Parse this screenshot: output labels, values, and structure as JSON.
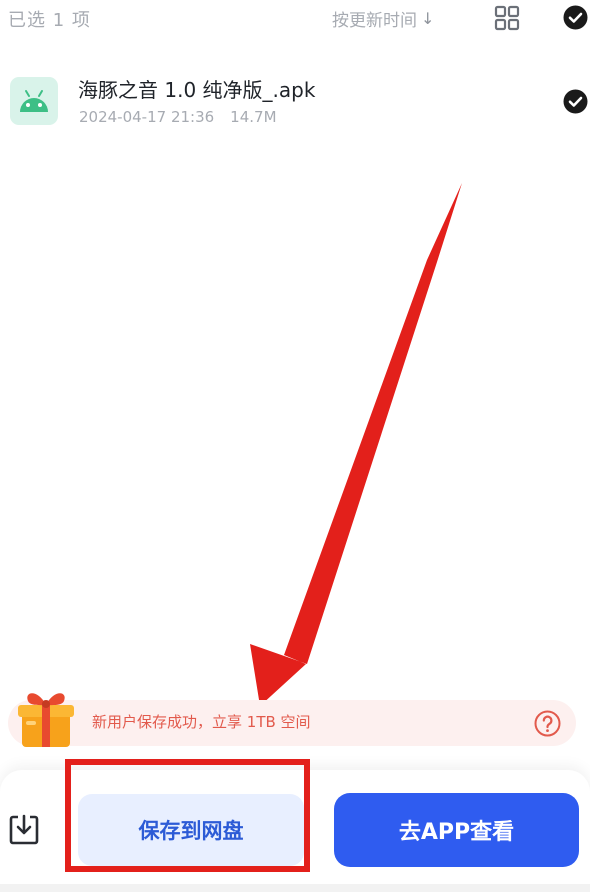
{
  "header": {
    "selected_count": "已选 1 项",
    "sort_label": "按更新时间",
    "sort_arrow": "↓",
    "grid_icon": "grid-icon",
    "check_all_icon": "check-circle-icon"
  },
  "file": {
    "name": "海豚之音 1.0 纯净版_.apk",
    "date": "2024-04-17 21:36",
    "size": "14.7M",
    "icon": "android-icon",
    "selected_icon": "check-circle-icon"
  },
  "promo": {
    "text": "新用户保存成功，立享 1TB 空间",
    "gift_icon": "gift-icon",
    "help_icon": "help-circle-icon"
  },
  "bottom": {
    "download_icon": "download-icon",
    "save_label": "保存到网盘",
    "open_app_label": "去APP查看"
  },
  "colors": {
    "primary": "#2f5cf0",
    "annotation_red": "#e3201b",
    "promo_text": "#e25a4c",
    "promo_bg": "#fdf0ef"
  }
}
